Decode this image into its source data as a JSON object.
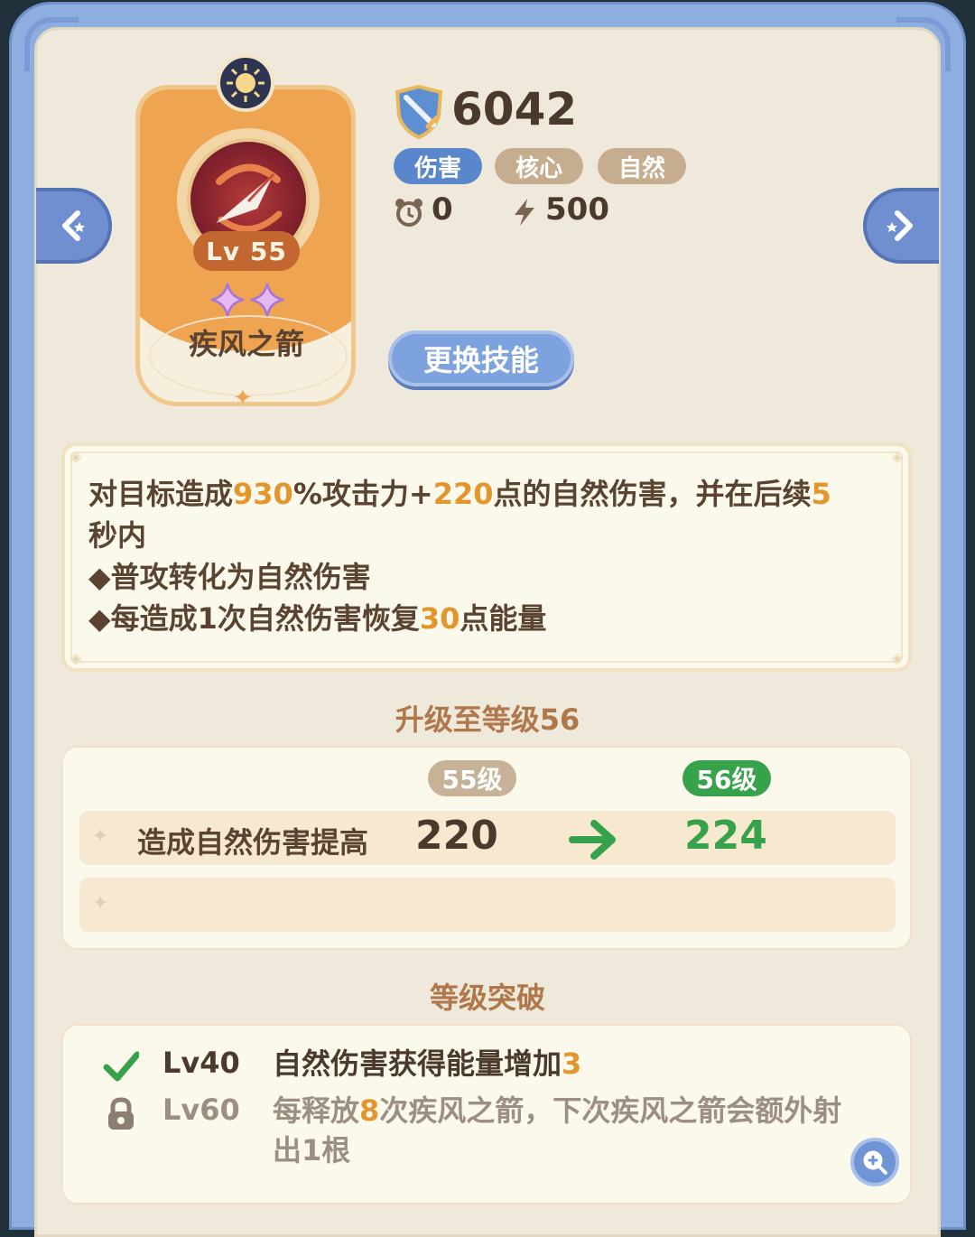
{
  "skill": {
    "name": "疾风之箭",
    "level_badge": "Lv 55",
    "star_count": 2
  },
  "header": {
    "power": "6042",
    "tags": [
      "伤害",
      "核心",
      "自然"
    ],
    "cooldown": "0",
    "energy": "500",
    "change_button": "更换技能"
  },
  "description": {
    "line1_parts": [
      "对目标造成",
      "930",
      "%攻击力+",
      "220",
      "点的自然伤害，并在后续",
      "5"
    ],
    "line2": "秒内",
    "bullet1": "◆普攻转化为自然伤害",
    "bullet2_parts": [
      "◆每造成1次自然伤害恢复",
      "30",
      "点能量"
    ]
  },
  "upgrade": {
    "title": "升级至等级56",
    "current_level": "55级",
    "next_level": "56级",
    "rows": [
      {
        "label": "造成自然伤害提高",
        "old": "220",
        "new": "224"
      },
      {
        "label": "",
        "old": "",
        "new": ""
      }
    ]
  },
  "breakthrough": {
    "title": "等级突破",
    "items": [
      {
        "level": "Lv40",
        "text_parts": [
          "自然伤害获得能量增加",
          "3",
          ""
        ],
        "unlocked": true
      },
      {
        "level": "Lv60",
        "text_parts": [
          "每释放",
          "8",
          "次疾风之箭，下次疾风之箭会额外射出1根"
        ],
        "unlocked": false
      }
    ]
  },
  "colors": {
    "accent_blue": "#5a86cc",
    "highlight_orange": "#e3962c",
    "green": "#37a24c",
    "text_brown": "#5a4330"
  },
  "icons": {
    "power": "shield-sword-icon",
    "cooldown": "alarm-clock-icon",
    "energy": "lightning-icon",
    "prev": "chevron-left-icon",
    "next": "chevron-right-icon",
    "done": "checkmark-icon",
    "locked": "lock-icon",
    "zoom": "zoom-in-icon"
  }
}
